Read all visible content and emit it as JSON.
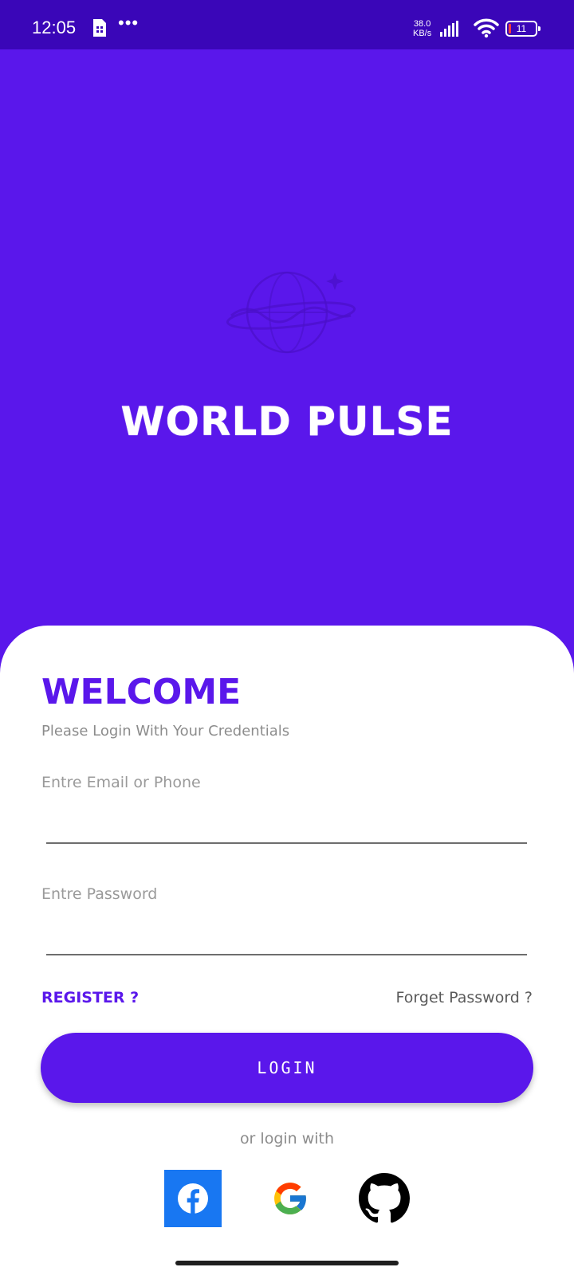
{
  "status_bar": {
    "time": "12:05",
    "dots": "•••",
    "speed_value": "38.0",
    "speed_unit": "KB/s",
    "battery": "11",
    "signal_icon": "signal-bars-icon",
    "wifi_icon": "wifi-icon"
  },
  "hero": {
    "title": "WORLD PULSE",
    "logo": "world-pulse-globe-logo"
  },
  "login": {
    "welcome": "WELCOME",
    "subtitle": "Please Login With Your Credentials",
    "email_label": "Entre Email or Phone",
    "email_value": "",
    "password_label": "Entre Password",
    "password_value": "",
    "register": "REGISTER ?",
    "forget_password": "Forget Password ?",
    "login_button": "LOGIN",
    "or_login_with": "or login with"
  },
  "social": {
    "facebook_icon": "facebook-icon",
    "google_icon": "google-icon",
    "github_icon": "github-icon"
  },
  "colors": {
    "brand": "#5a17eb",
    "status_bar": "#3a06b8",
    "facebook": "#1877f2"
  }
}
